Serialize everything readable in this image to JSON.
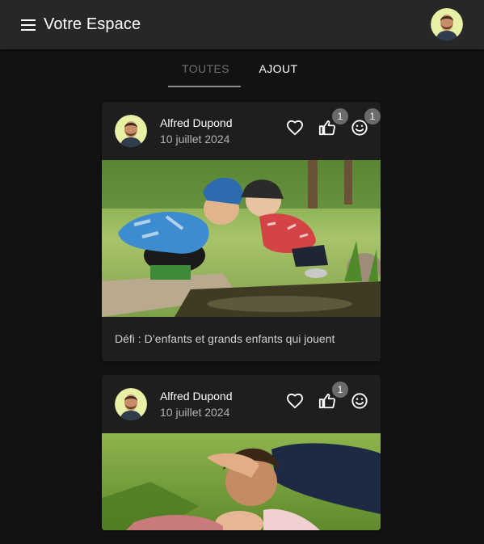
{
  "app": {
    "title": "Votre Espace"
  },
  "icons": {
    "menu": "menu-icon",
    "like": "heart-outline-icon",
    "thumb": "thumb-up-outline-icon",
    "smile": "emoticon-smile-outline-icon"
  },
  "colors": {
    "appbar": "#272727",
    "background": "#121212",
    "card": "#1e1e1e",
    "badge": "#6b6b6b"
  },
  "tabs": [
    {
      "label": "TOUTES",
      "active": false
    },
    {
      "label": "AJOUT",
      "active": true
    }
  ],
  "posts": [
    {
      "author": "Alfred Dupond",
      "date": "10 juillet 2024",
      "badges": {
        "thumb": "1",
        "smile": "1"
      },
      "text": "Défi : D’enfants et grands enfants qui jouent"
    },
    {
      "author": "Alfred Dupond",
      "date": "10 juillet 2024",
      "badges": {
        "thumb": "1"
      }
    }
  ]
}
